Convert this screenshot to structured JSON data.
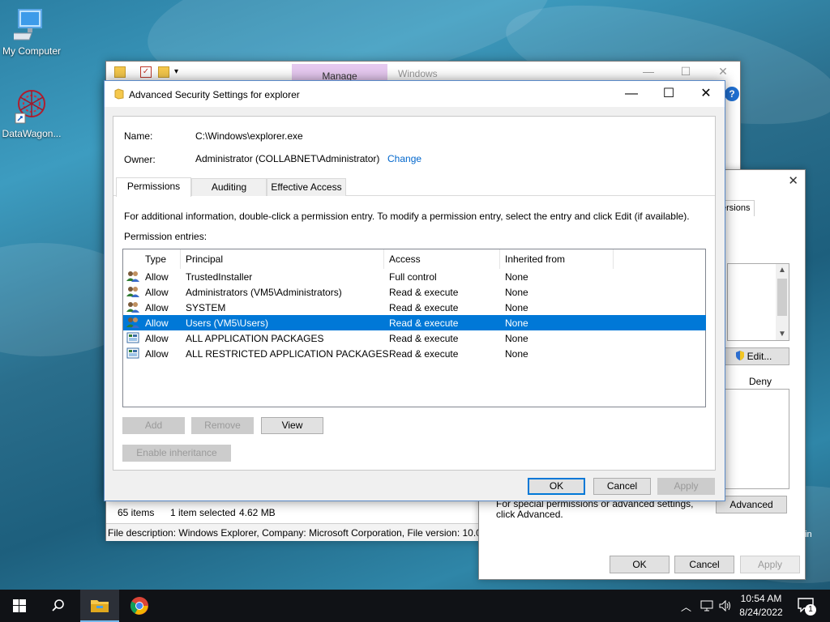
{
  "desktop": {
    "icons": [
      {
        "label": "My Computer"
      },
      {
        "label": "DataWagon..."
      }
    ]
  },
  "explorer": {
    "manage_tab": "Manage",
    "title": "Windows",
    "status_items": "65 items",
    "status_selected": "1 item selected",
    "status_size": "4.62 MB",
    "description": "File description: Windows Explorer, Company: Microsoft Corporation, File version: 10.0."
  },
  "properties": {
    "tab_partial": "ersions",
    "edit_label": "Edit...",
    "deny_label": "Deny",
    "note": "For special permissions or advanced settings, click Advanced.",
    "advanced_label": "Advanced",
    "ok_label": "OK",
    "cancel_label": "Cancel",
    "apply_label": "Apply",
    "partial_text": "in"
  },
  "dialog": {
    "title": "Advanced Security Settings for explorer",
    "name_label": "Name:",
    "name_value": "C:\\Windows\\explorer.exe",
    "owner_label": "Owner:",
    "owner_value": "Administrator (COLLABNET\\Administrator)",
    "change_link": "Change",
    "tabs": [
      "Permissions",
      "Auditing",
      "Effective Access"
    ],
    "info_text": "For additional information, double-click a permission entry. To modify a permission entry, select the entry and click Edit (if available).",
    "entries_label": "Permission entries:",
    "columns": [
      "Type",
      "Principal",
      "Access",
      "Inherited from"
    ],
    "rows": [
      {
        "type": "Allow",
        "principal": "TrustedInstaller",
        "access": "Full control",
        "inherited": "None",
        "icon": "users-icon"
      },
      {
        "type": "Allow",
        "principal": "Administrators (VM5\\Administrators)",
        "access": "Read & execute",
        "inherited": "None",
        "icon": "users-icon"
      },
      {
        "type": "Allow",
        "principal": "SYSTEM",
        "access": "Read & execute",
        "inherited": "None",
        "icon": "users-icon"
      },
      {
        "type": "Allow",
        "principal": "Users (VM5\\Users)",
        "access": "Read & execute",
        "inherited": "None",
        "icon": "users-icon"
      },
      {
        "type": "Allow",
        "principal": "ALL APPLICATION PACKAGES",
        "access": "Read & execute",
        "inherited": "None",
        "icon": "package-icon"
      },
      {
        "type": "Allow",
        "principal": "ALL RESTRICTED APPLICATION PACKAGES",
        "access": "Read & execute",
        "inherited": "None",
        "icon": "package-icon"
      }
    ],
    "selected_row": 3,
    "add_label": "Add",
    "remove_label": "Remove",
    "view_label": "View",
    "enable_inheritance_label": "Enable inheritance",
    "ok_label": "OK",
    "cancel_label": "Cancel",
    "apply_label": "Apply"
  },
  "taskbar": {
    "time": "10:54 AM",
    "date": "8/24/2022",
    "notification_count": "1"
  },
  "colors": {
    "selection": "#0078d7",
    "link": "#0066cc",
    "manage_tab": "#e6c9f0"
  }
}
